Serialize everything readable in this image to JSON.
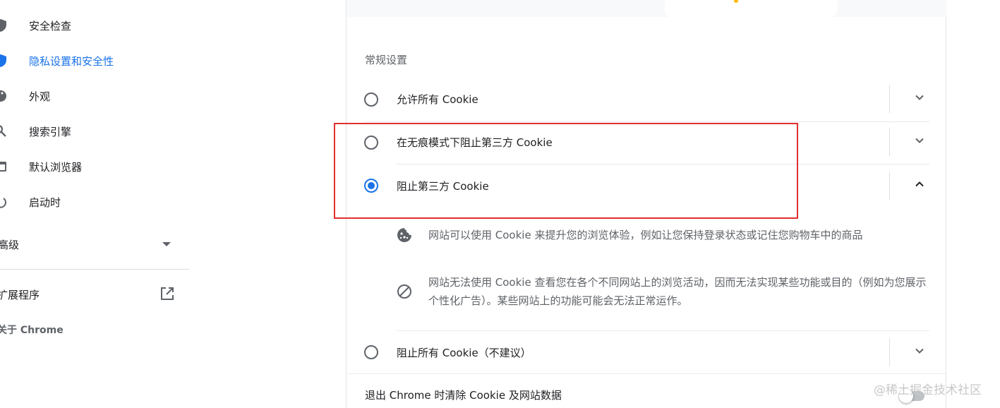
{
  "sidebar": {
    "items": [
      {
        "label": "安全检查",
        "icon": "shield-check-icon"
      },
      {
        "label": "隐私设置和安全性",
        "icon": "shield-icon"
      },
      {
        "label": "外观",
        "icon": "palette-icon"
      },
      {
        "label": "搜索引擎",
        "icon": "search-icon"
      },
      {
        "label": "默认浏览器",
        "icon": "browser-icon"
      },
      {
        "label": "启动时",
        "icon": "power-icon"
      }
    ],
    "advanced_label": "高级",
    "extensions_label": "扩展程序",
    "about_label": "关于 Chrome"
  },
  "main": {
    "section_title": "常规设置",
    "options": [
      {
        "label": "允许所有 Cookie",
        "checked": false
      },
      {
        "label": "在无痕模式下阻止第三方 Cookie",
        "checked": false
      },
      {
        "label": "阻止第三方 Cookie",
        "checked": true
      },
      {
        "label": "阻止所有 Cookie（不建议）",
        "checked": false
      }
    ],
    "details": [
      {
        "icon": "cookie-icon",
        "text": "网站可以使用 Cookie 来提升您的浏览体验，例如让您保持登录状态或记住您购物车中的商品"
      },
      {
        "icon": "block-icon",
        "text": "网站无法使用 Cookie 查看您在各个不同网站上的浏览活动，因而无法实现某些功能或目的（例如为您展示个性化广告）。某些网站上的功能可能会无法正常运作。"
      }
    ],
    "clear_on_exit_label": "退出 Chrome 时清除 Cookie 及网站数据"
  },
  "watermark": "@稀土掘金技术社区",
  "colors": {
    "accent": "#1a73e8",
    "highlight_border": "#e0302f",
    "text_primary": "#202124",
    "text_secondary": "#5f6368"
  }
}
